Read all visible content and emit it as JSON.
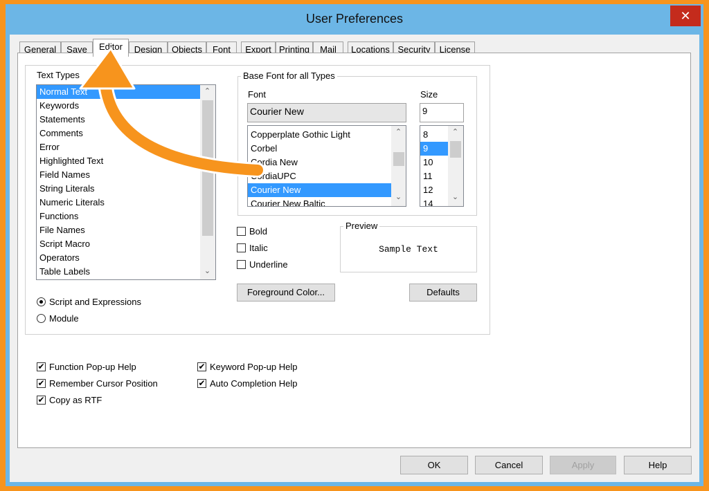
{
  "window": {
    "title": "User Preferences",
    "close_glyph": "✕"
  },
  "tabs": [
    "General",
    "Save",
    "Editor",
    "Design",
    "Objects",
    "Font",
    "Export",
    "Printing",
    "Mail",
    "Locations",
    "Security",
    "License"
  ],
  "active_tab": "Editor",
  "text_types": {
    "label": "Text Types",
    "items": [
      "Normal Text",
      "Keywords",
      "Statements",
      "Comments",
      "Error",
      "Highlighted Text",
      "Field Names",
      "String Literals",
      "Numeric Literals",
      "Functions",
      "File Names",
      "Script Macro",
      "Operators",
      "Table Labels"
    ],
    "selected": "Normal Text"
  },
  "mode": {
    "script_label": "Script and Expressions",
    "module_label": "Module",
    "selected": "Script and Expressions"
  },
  "base_font": {
    "group_label": "Base Font for all Types",
    "font_label": "Font",
    "size_label": "Size",
    "font_value": "Courier New",
    "size_value": "9",
    "fonts": [
      "Copperplate Gothic Light",
      "Corbel",
      "Cordia New",
      "CordiaUPC",
      "Courier New",
      "Courier New Baltic"
    ],
    "selected_font": "Courier New",
    "sizes": [
      "8",
      "9",
      "10",
      "11",
      "12",
      "14"
    ],
    "selected_size": "9"
  },
  "style": {
    "bold_label": "Bold",
    "italic_label": "Italic",
    "underline_label": "Underline",
    "bold": false,
    "italic": false,
    "underline": false
  },
  "preview": {
    "label": "Preview",
    "sample": "Sample Text"
  },
  "buttons": {
    "foreground": "Foreground Color...",
    "defaults": "Defaults",
    "ok": "OK",
    "cancel": "Cancel",
    "apply": "Apply",
    "help": "Help"
  },
  "options": {
    "function_popup": "Function Pop-up Help",
    "remember_cursor": "Remember Cursor Position",
    "copy_rtf": "Copy as RTF",
    "keyword_popup": "Keyword Pop-up Help",
    "auto_completion": "Auto Completion Help",
    "check_glyph": "✔"
  },
  "annotation": {
    "color": "#f7941d",
    "icon": "curved-arrow-icon"
  },
  "colors": {
    "frame": "#f7941d",
    "titlebar": "#6cb6e6",
    "selection": "#3399ff",
    "close": "#c42b1c"
  }
}
